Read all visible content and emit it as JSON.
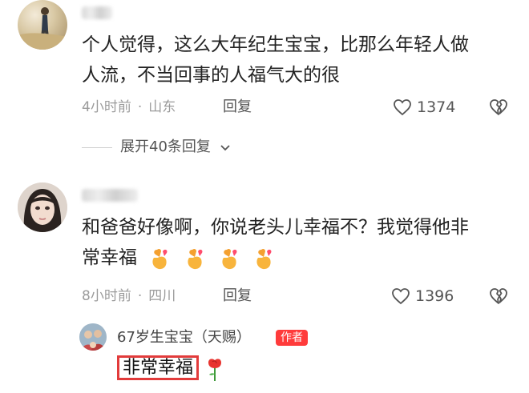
{
  "comments": [
    {
      "text_line1": "个人觉得，这么大年纪生宝宝，比那么年轻人做",
      "text_line2": "人流，不当回事的人福气大的很",
      "time": "4小时前",
      "location": "山东",
      "reply_label": "回复",
      "likes": "1374"
    },
    {
      "text_line1": "和爸爸好像啊，你说老头儿幸福不？我觉得他非",
      "text_line2": "常幸福",
      "time": "8小时前",
      "location": "四川",
      "reply_label": "回复",
      "likes": "1396"
    }
  ],
  "expand_replies": "展开40条回复",
  "author_reply": {
    "name": "67岁生宝宝（天赐）",
    "badge": "作者",
    "text": "非常幸福"
  },
  "colors": {
    "accent_red": "#e23b3b",
    "meta_gray": "#9b9b9b",
    "heart_orange": "#f6a23a"
  },
  "icons": [
    "heart-outline-icon",
    "broken-heart-icon",
    "chevron-down-icon",
    "finger-heart-emoji",
    "rose-emoji"
  ]
}
